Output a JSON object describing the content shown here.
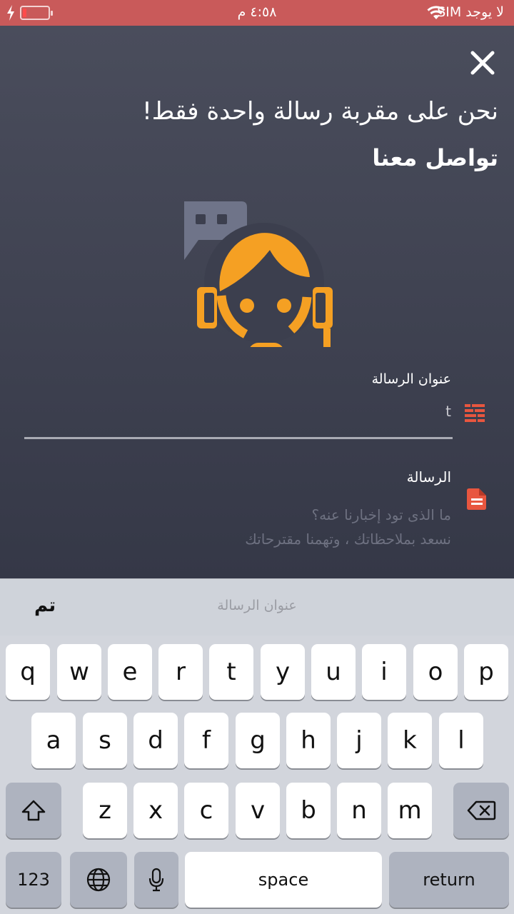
{
  "status_bar": {
    "carrier": "لا يوجد SIM",
    "time": "٤:٥٨ م",
    "battery_level": 0.15,
    "colors": {
      "background": "#c95a5a",
      "battery_fill": "#ff4b4b"
    }
  },
  "header": {
    "headline": "نحن على مقربة رسالة واحدة فقط!",
    "subhead": "تواصل معنا"
  },
  "form": {
    "subject": {
      "label": "عنوان الرسالة",
      "value": "t",
      "icon": "subject-lines-icon"
    },
    "message": {
      "label": "الرسالة",
      "placeholder": "ما الذى تود إخبارنا عنه؟\nنسعد بملاحظاتك ، وتهمنا مقترحاتك",
      "icon": "document-icon"
    }
  },
  "keyboard": {
    "toolbar_hint": "عنوان الرسالة",
    "done_label": "تم",
    "row1": [
      "q",
      "w",
      "e",
      "r",
      "t",
      "y",
      "u",
      "i",
      "o",
      "p"
    ],
    "row2": [
      "a",
      "s",
      "d",
      "f",
      "g",
      "h",
      "j",
      "k",
      "l"
    ],
    "row3": [
      "z",
      "x",
      "c",
      "v",
      "b",
      "n",
      "m"
    ],
    "numbers_label": "123",
    "space_label": "space",
    "return_label": "return"
  },
  "colors": {
    "accent": "#f5a023",
    "icon_red": "#e8563f",
    "bubble": "#6f7489"
  }
}
